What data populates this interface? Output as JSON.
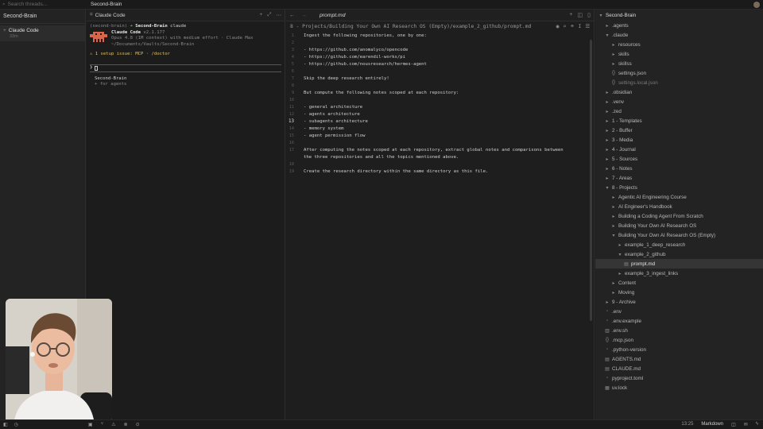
{
  "topbar": {
    "search_placeholder": "Search threads...",
    "window_title": "Second-Brain"
  },
  "threads": {
    "header": "Second-Brain",
    "items": [
      {
        "label": "Claude Code",
        "time": "33m"
      }
    ]
  },
  "terminal": {
    "tab_label": "Claude Code",
    "prompt_env": "(second-brain)",
    "prompt_dir": "Second-Brain",
    "prompt_cmd": "claude",
    "product": "Claude Code",
    "version": "v2.1.177",
    "model_line": "Opus 4.8 (1M context) with medium effort · Claude Max",
    "path_line": "~/Documents/Vaults/Second-Brain",
    "setup_issue": "⚠ 1 setup issue: MCP · /doctor",
    "input_caret": "❯",
    "suggest_title": "Second-Brain",
    "suggest_sub": "+ for agents"
  },
  "editor": {
    "tab_label": "prompt.md",
    "breadcrumb": "8 - Projects/Building Your Own AI Research OS (Empty)/example_2_github/prompt.md",
    "current_line": 13,
    "lines": [
      {
        "n": "1",
        "text": "Ingest the following repositories, one by one:"
      },
      {
        "n": "2",
        "text": ""
      },
      {
        "n": "3",
        "text": "- https://github.com/anomalyco/opencode"
      },
      {
        "n": "4",
        "text": "- https://github.com/earendil-works/pi"
      },
      {
        "n": "5",
        "text": "- https://github.com/nousresearch/hermes-agent"
      },
      {
        "n": "6",
        "text": ""
      },
      {
        "n": "7",
        "text": "Skip the deep research entirely!"
      },
      {
        "n": "8",
        "text": ""
      },
      {
        "n": "9",
        "text": "But compute the following notes scoped at each repository:"
      },
      {
        "n": "10",
        "text": ""
      },
      {
        "n": "11",
        "text": "- general architecture"
      },
      {
        "n": "12",
        "text": "- agents architecture"
      },
      {
        "n": "13",
        "text": "- subagents architecture"
      },
      {
        "n": "14",
        "text": "- memory system"
      },
      {
        "n": "15",
        "text": "- agent permission flow"
      },
      {
        "n": "16",
        "text": ""
      },
      {
        "n": "17",
        "text": "After computing the notes scoped at each repository, extract global notes and comparisons between"
      },
      {
        "n": "",
        "text": "the three repositories and all the topics mentioned above."
      },
      {
        "n": "18",
        "text": ""
      },
      {
        "n": "19",
        "text": "Create the research directory within the same directory as this file."
      }
    ]
  },
  "tree": {
    "root": "Second-Brain",
    "items": [
      {
        "label": ".agents",
        "depth": 1,
        "icon": "folder-icon"
      },
      {
        "label": ".claude",
        "depth": 1,
        "icon": "folder-open-icon"
      },
      {
        "label": "resources",
        "depth": 2,
        "icon": "folder-icon"
      },
      {
        "label": "skills",
        "depth": 2,
        "icon": "folder-icon"
      },
      {
        "label": "skillss",
        "depth": 2,
        "icon": "folder-icon"
      },
      {
        "label": "settings.json",
        "depth": 2,
        "icon": "braces-icon"
      },
      {
        "label": "settings.local.json",
        "depth": 2,
        "icon": "braces-icon",
        "dim": true
      },
      {
        "label": ".obsidian",
        "depth": 1,
        "icon": "folder-icon"
      },
      {
        "label": ".venv",
        "depth": 1,
        "icon": "folder-icon"
      },
      {
        "label": ".zed",
        "depth": 1,
        "icon": "folder-icon"
      },
      {
        "label": "1 - Templates",
        "depth": 1,
        "icon": "folder-icon"
      },
      {
        "label": "2 - Buffer",
        "depth": 1,
        "icon": "folder-icon"
      },
      {
        "label": "3 - Media",
        "depth": 1,
        "icon": "folder-icon"
      },
      {
        "label": "4 - Journal",
        "depth": 1,
        "icon": "folder-icon"
      },
      {
        "label": "5 - Sources",
        "depth": 1,
        "icon": "folder-icon"
      },
      {
        "label": "6 - Notes",
        "depth": 1,
        "icon": "folder-icon"
      },
      {
        "label": "7 - Areas",
        "depth": 1,
        "icon": "folder-icon"
      },
      {
        "label": "8 - Projects",
        "depth": 1,
        "icon": "folder-open-icon"
      },
      {
        "label": "Agentic AI Engineering Course",
        "depth": 2,
        "icon": "folder-icon"
      },
      {
        "label": "AI Engineer's Handbook",
        "depth": 2,
        "icon": "folder-icon"
      },
      {
        "label": "Building a Coding Agent From Scratch",
        "depth": 2,
        "icon": "folder-icon"
      },
      {
        "label": "Building Your Own AI Research OS",
        "depth": 2,
        "icon": "folder-icon"
      },
      {
        "label": "Building Your Own AI Research OS (Empty)",
        "depth": 2,
        "icon": "folder-open-icon"
      },
      {
        "label": "example_1_deep_research",
        "depth": 3,
        "icon": "folder-icon"
      },
      {
        "label": "example_2_github",
        "depth": 3,
        "icon": "folder-open-icon"
      },
      {
        "label": "prompt.md",
        "depth": 4,
        "icon": "markdown-file-icon",
        "active": true
      },
      {
        "label": "example_3_ingest_links",
        "depth": 3,
        "icon": "folder-icon"
      },
      {
        "label": "Content",
        "depth": 2,
        "icon": "folder-icon"
      },
      {
        "label": "Moving",
        "depth": 2,
        "icon": "folder-icon"
      },
      {
        "label": "9 - Archive",
        "depth": 1,
        "icon": "folder-icon"
      },
      {
        "label": ".env",
        "depth": 1,
        "icon": "file-icon"
      },
      {
        "label": ".env.example",
        "depth": 1,
        "icon": "file-icon"
      },
      {
        "label": ".env.sh",
        "depth": 1,
        "icon": "terminal-file-icon"
      },
      {
        "label": ".mcp.json",
        "depth": 1,
        "icon": "braces-icon"
      },
      {
        "label": ".python-version",
        "depth": 1,
        "icon": "file-icon"
      },
      {
        "label": "AGENTS.md",
        "depth": 1,
        "icon": "markdown-file-icon"
      },
      {
        "label": "CLAUDE.md",
        "depth": 1,
        "icon": "markdown-file-icon"
      },
      {
        "label": "pyproject.toml",
        "depth": 1,
        "icon": "file-icon"
      },
      {
        "label": "uv.lock",
        "depth": 1,
        "icon": "lock-file-icon"
      }
    ]
  },
  "status": {
    "cursor_pos": "13:25",
    "language": "Markdown"
  }
}
